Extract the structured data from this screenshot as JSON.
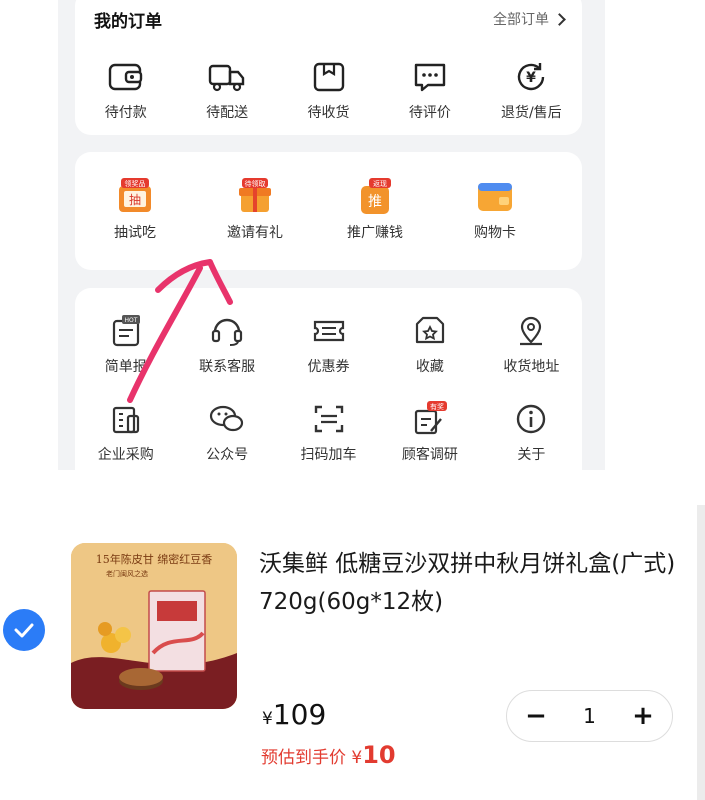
{
  "orders": {
    "title": "我的订单",
    "all_label": "全部订单",
    "items": [
      {
        "label": "待付款",
        "icon": "wallet-icon"
      },
      {
        "label": "待配送",
        "icon": "truck-icon"
      },
      {
        "label": "待收货",
        "icon": "package-icon"
      },
      {
        "label": "待评价",
        "icon": "chat-bubble-icon"
      },
      {
        "label": "退货/售后",
        "icon": "refund-icon"
      }
    ]
  },
  "promos": {
    "items": [
      {
        "label": "抽试吃",
        "badge": "领奖品",
        "icon": "draw-icon"
      },
      {
        "label": "邀请有礼",
        "badge": "待领取",
        "icon": "gift-icon"
      },
      {
        "label": "推广赚钱",
        "badge": "返现",
        "icon": "promote-icon"
      },
      {
        "label": "购物卡",
        "icon": "card-icon"
      }
    ]
  },
  "tools": {
    "row1": [
      {
        "label": "简单报",
        "icon": "hot-report-icon",
        "badge": "HOT"
      },
      {
        "label": "联系客服",
        "icon": "headset-icon"
      },
      {
        "label": "优惠券",
        "icon": "coupon-icon"
      },
      {
        "label": "收藏",
        "icon": "favorite-icon"
      },
      {
        "label": "收货地址",
        "icon": "location-icon"
      }
    ],
    "row2": [
      {
        "label": "企业采购",
        "icon": "enterprise-icon"
      },
      {
        "label": "公众号",
        "icon": "wechat-icon"
      },
      {
        "label": "扫码加车",
        "icon": "scan-icon"
      },
      {
        "label": "顾客调研",
        "icon": "survey-icon",
        "badge": "有奖"
      },
      {
        "label": "关于",
        "icon": "info-icon"
      }
    ]
  },
  "product": {
    "title": "沃集鲜 低糖豆沙双拼中秋月饼礼盒(广式) 720g(60g*12枚)",
    "price_currency": "¥",
    "price": "109",
    "estimate_label": "预估到手价",
    "estimate_currency": "¥",
    "estimate_value": "10",
    "quantity": "1",
    "minus": "−",
    "plus": "+",
    "selected": true,
    "thumb_text_line1": "15年陈皮甘 绵密红豆香",
    "thumb_text_line2": "老门闽风之选"
  },
  "colors": {
    "accent_blue": "#2b7cf7",
    "price_red": "#e23b30",
    "annotation_pink": "#e8336b"
  }
}
